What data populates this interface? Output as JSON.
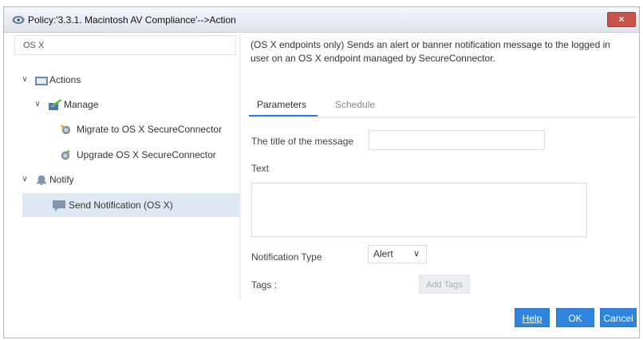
{
  "window": {
    "title": "Policy:'3.3.1. Macintosh AV Compliance'-->Action",
    "close_label": "×"
  },
  "search": {
    "value": "OS X",
    "placeholder": ""
  },
  "tree": {
    "actions_label": "Actions",
    "manage_label": "Manage",
    "migrate_label": "Migrate to OS X SecureConnector",
    "upgrade_label": "Upgrade OS X SecureConnector",
    "notify_label": "Notify",
    "send_notification_label": "Send Notification (OS X)"
  },
  "description": "(OS X endpoints only) Sends an alert or banner notification message to the logged in user on an OS X endpoint managed by SecureConnector.",
  "tabs": {
    "parameters": "Parameters",
    "schedule": "Schedule"
  },
  "form": {
    "title_label": "The title of the message",
    "title_value": "",
    "text_label": "Text",
    "text_value": "",
    "notification_type_label": "Notification Type",
    "notification_type_value": "Alert",
    "tags_label": "Tags :",
    "add_tags_label": "Add Tags"
  },
  "buttons": {
    "help": "Help",
    "ok": "OK",
    "cancel": "Cancel"
  },
  "icons": {
    "window": "forescout-eye-icon",
    "actions": "folder-icon",
    "manage": "manage-icon",
    "migrate": "migrate-icon",
    "upgrade": "upgrade-icon",
    "notify": "bell-icon",
    "send_notification": "message-icon"
  },
  "colors": {
    "accent": "#2f84de",
    "close": "#c9524a",
    "selected_row": "#dfe9f3"
  }
}
